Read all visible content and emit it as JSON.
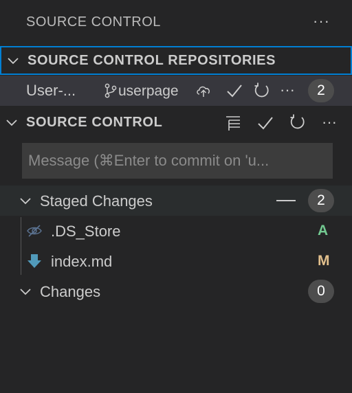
{
  "panel": {
    "title": "SOURCE CONTROL",
    "more": "···"
  },
  "repositories": {
    "header": "SOURCE CONTROL REPOSITORIES",
    "repo": {
      "name": "User-...",
      "branch": "userpage",
      "more": "···",
      "badge": "2"
    }
  },
  "source_control": {
    "header": "SOURCE CONTROL",
    "more": "···",
    "message_placeholder": "Message (⌘Enter to commit on 'u..."
  },
  "staged": {
    "label": "Staged Changes",
    "badge": "2",
    "files": [
      {
        "name": ".DS_Store",
        "status": "A",
        "icon": "eye-closed-icon",
        "status_color": "#73c991"
      },
      {
        "name": "index.md",
        "status": "M",
        "icon": "markdown-arrow-icon",
        "status_color": "#e2c08d"
      }
    ]
  },
  "changes": {
    "label": "Changes",
    "badge": "0"
  },
  "colors": {
    "background": "#252526",
    "focus_border": "#007fd4",
    "selected_row": "#37373d",
    "accent_blue": "#519aba"
  }
}
